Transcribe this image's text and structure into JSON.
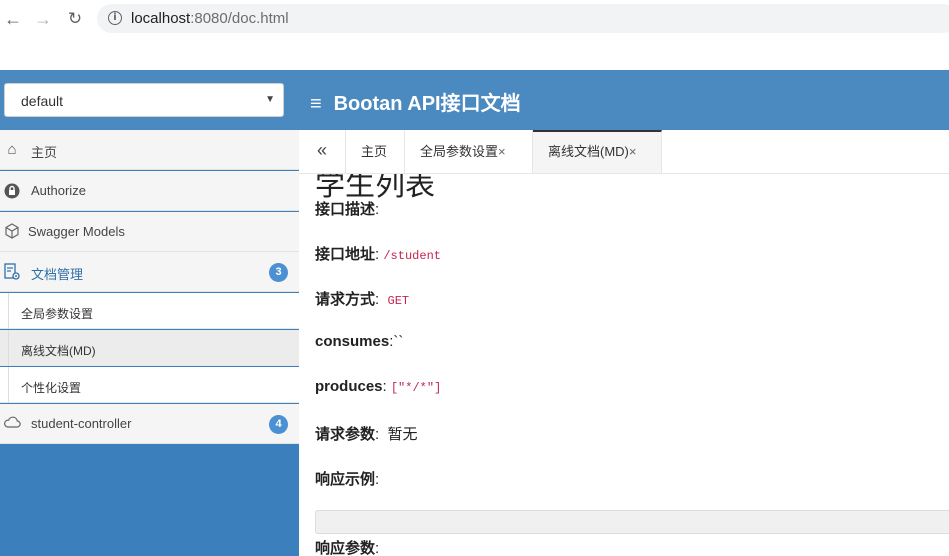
{
  "browser": {
    "url_host": "localhost",
    "url_rest": ":8080/doc.html"
  },
  "header": {
    "group_select_value": "default",
    "brand_title": "Bootan API接口文档"
  },
  "sidebar": {
    "items": [
      {
        "label": "主页",
        "icon": "home-icon"
      },
      {
        "label": "Authorize",
        "icon": "lock-icon"
      },
      {
        "label": "Swagger Models",
        "icon": "cube-icon"
      },
      {
        "label": "文档管理",
        "icon": "doc-settings-icon",
        "badge": "3"
      },
      {
        "label": "student-controller",
        "icon": "cloud-icon",
        "badge": "4"
      }
    ],
    "sub_items": [
      "全局参数设置",
      "离线文档(MD)",
      "个性化设置"
    ]
  },
  "tabs": {
    "items": [
      "主页",
      "全局参数设置",
      "离线文档(MD)"
    ],
    "close": "×"
  },
  "content": {
    "title": "学生列表",
    "desc_label": "接口描述",
    "addr_label": "接口地址",
    "addr_value": "/student",
    "method_label": "请求方式",
    "method_value": "GET",
    "consumes_label": "consumes",
    "consumes_value": "``",
    "produces_label": "produces",
    "produces_value": "[\"*/*\"]",
    "params_label": "请求参数",
    "params_value": "暂无",
    "example_label": "响应示例",
    "resp_params_label": "响应参数"
  }
}
